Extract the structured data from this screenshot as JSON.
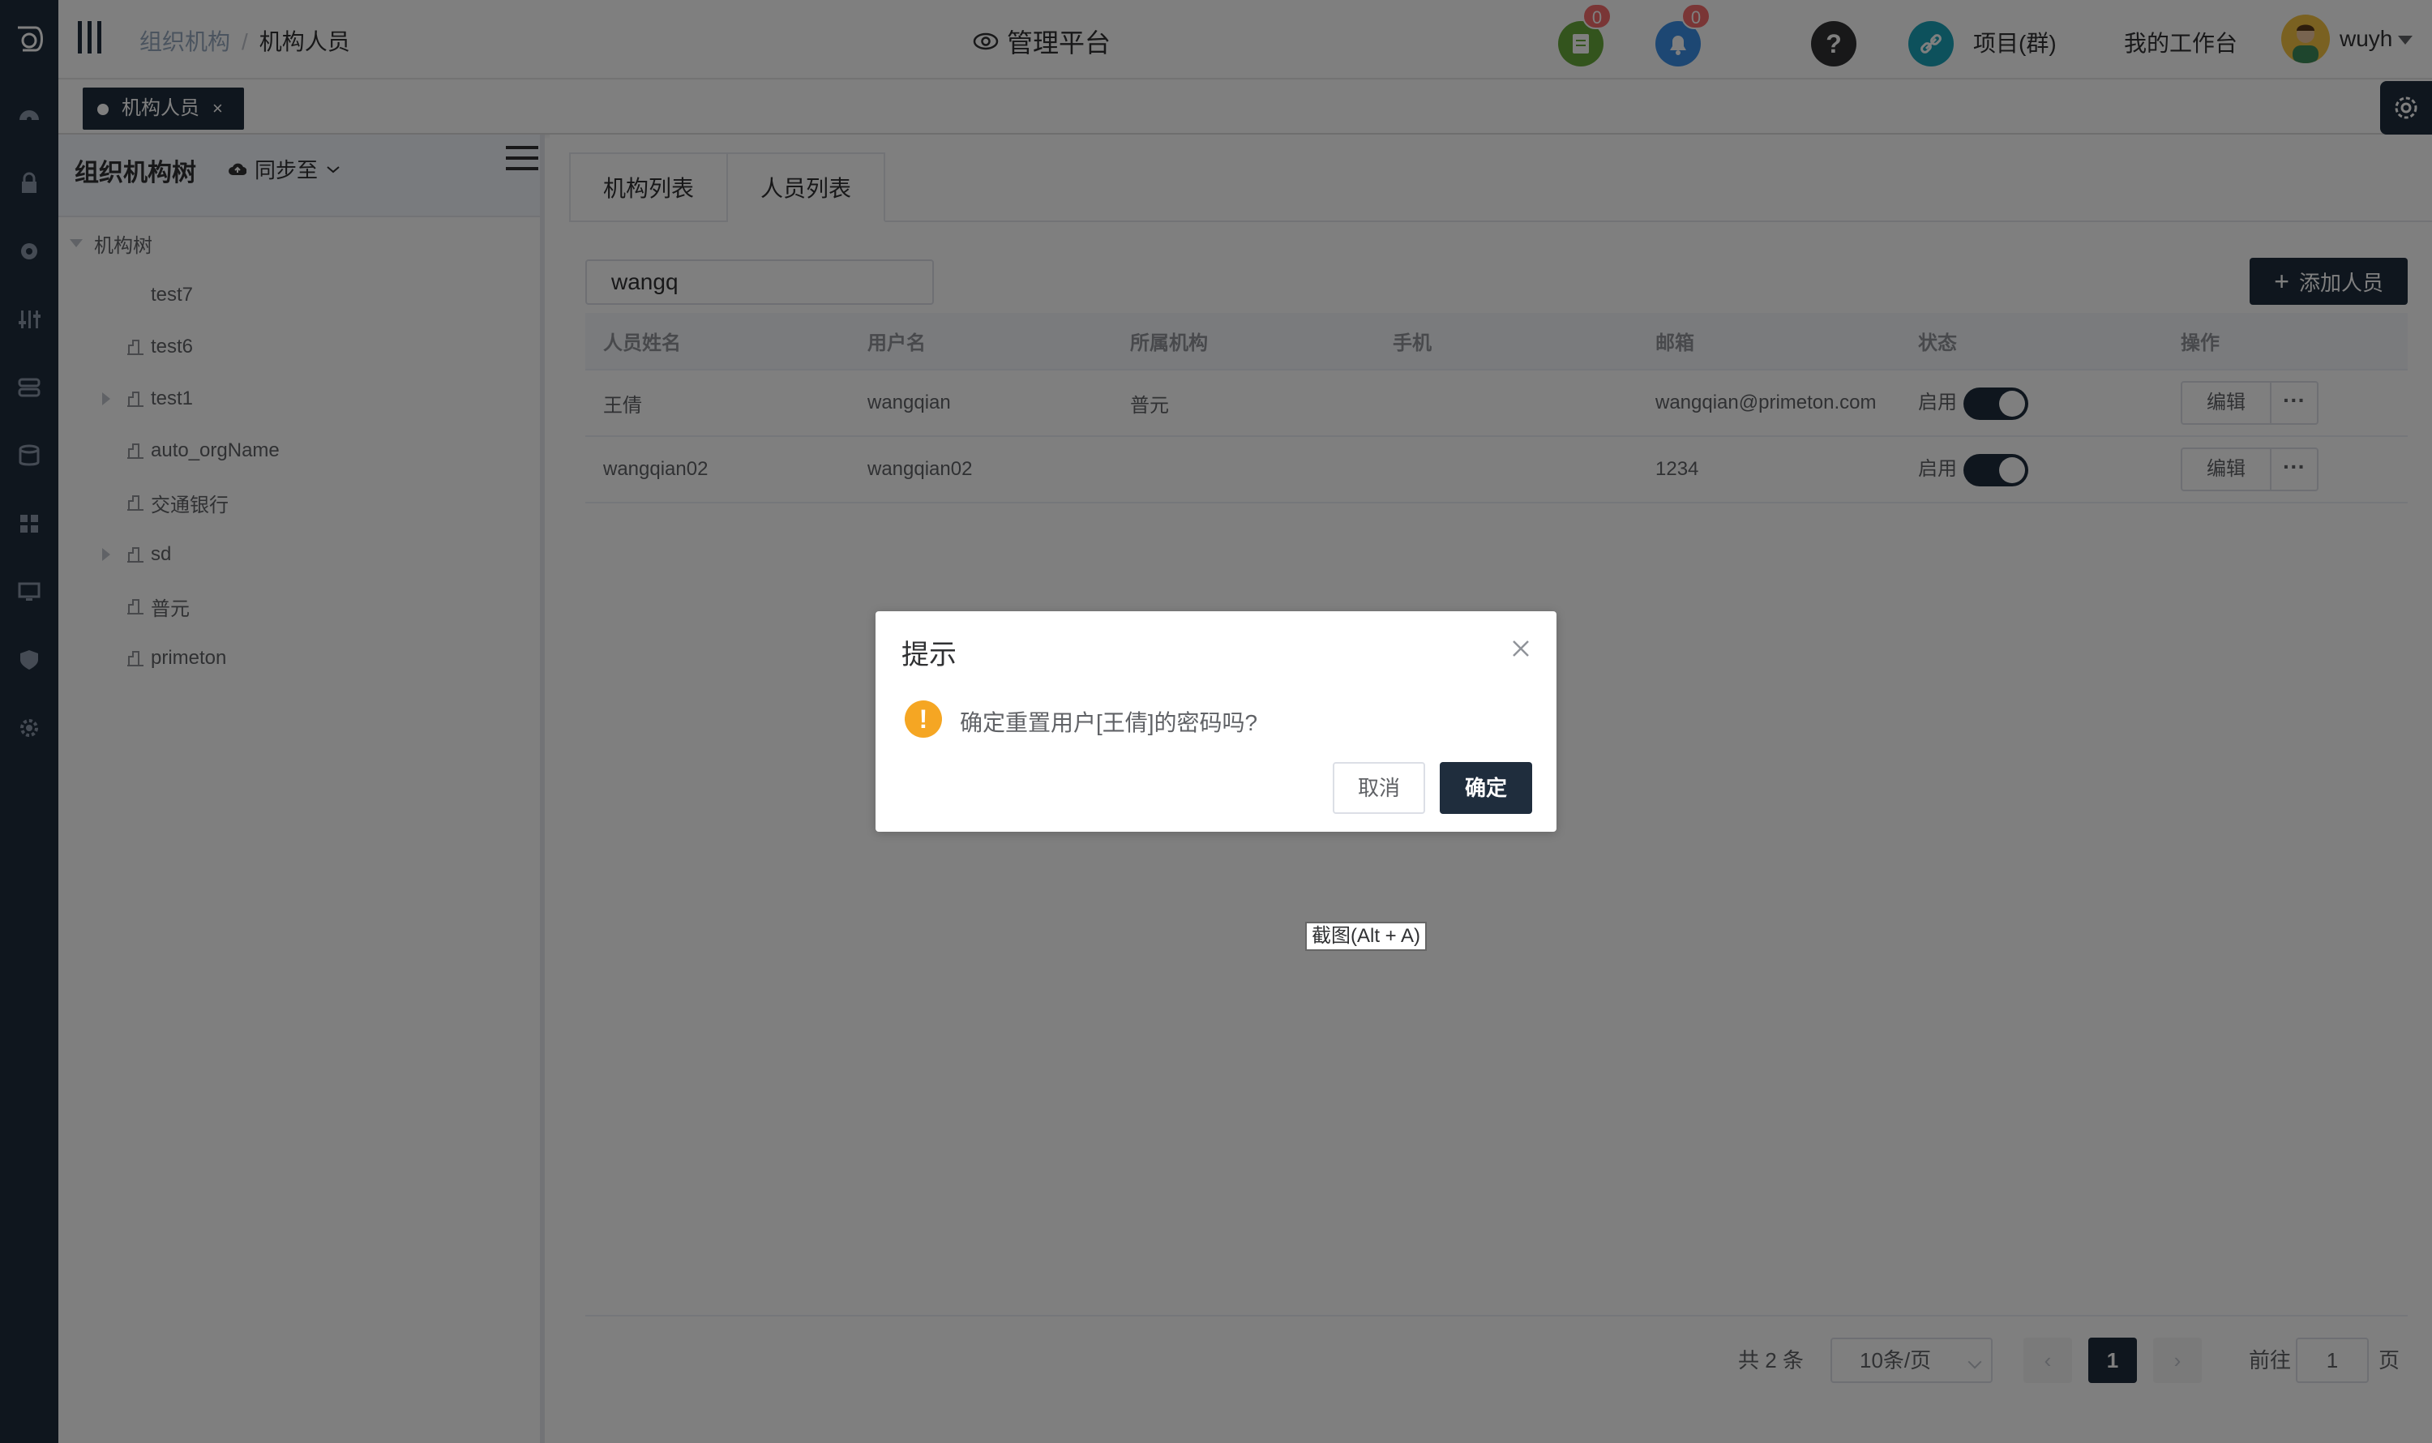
{
  "header": {
    "breadcrumb": [
      "组织机构",
      "机构人员"
    ],
    "breadcrumb_sep": "/",
    "platform_title": "管理平台",
    "badges": {
      "todo": "0",
      "notice": "0"
    },
    "links": {
      "project": "项目(群)",
      "workspace": "我的工作台"
    },
    "user": "wuyh"
  },
  "tags": {
    "active_tag": "机构人员",
    "close": "×"
  },
  "tree": {
    "title": "组织机构树",
    "sync_label": "同步至",
    "root": "机构树",
    "nodes": [
      {
        "label": "test7",
        "icon": false,
        "expandable": false
      },
      {
        "label": "test6",
        "icon": true,
        "expandable": false
      },
      {
        "label": "test1",
        "icon": true,
        "expandable": true
      },
      {
        "label": "auto_orgName",
        "icon": true,
        "expandable": false
      },
      {
        "label": "交通银行",
        "icon": true,
        "expandable": false
      },
      {
        "label": "sd",
        "icon": true,
        "expandable": true
      },
      {
        "label": "普元",
        "icon": true,
        "expandable": false
      },
      {
        "label": "primeton",
        "icon": true,
        "expandable": false
      }
    ]
  },
  "main": {
    "tabs": [
      "机构列表",
      "人员列表"
    ],
    "active_tab": 1,
    "search_value": "wangq",
    "add_button": "添加人员",
    "columns": [
      "人员姓名",
      "用户名",
      "所属机构",
      "手机",
      "邮箱",
      "状态",
      "操作"
    ],
    "rows": [
      {
        "name": "王倩",
        "username": "wangqian",
        "org": "普元",
        "phone": "",
        "email": "wangqian@primeton.com",
        "status": "启用",
        "enabled": true,
        "edit": "编辑",
        "more": "···"
      },
      {
        "name": "wangqian02",
        "username": "wangqian02",
        "org": "",
        "phone": "",
        "email": "1234",
        "status": "启用",
        "enabled": true,
        "edit": "编辑",
        "more": "···"
      }
    ]
  },
  "pagination": {
    "total": "共 2 条",
    "page_size": "10条/页",
    "current": "1",
    "goto_label": "前往",
    "goto_value": "1",
    "page_unit": "页"
  },
  "dialog": {
    "title": "提示",
    "message": "确定重置用户[王倩]的密码吗?",
    "cancel": "取消",
    "confirm": "确定"
  },
  "tooltip": "截图(Alt + A)",
  "colors": {
    "dark": "#1f2d3d",
    "warning": "#f5a623",
    "badge": "#f56c6c"
  }
}
